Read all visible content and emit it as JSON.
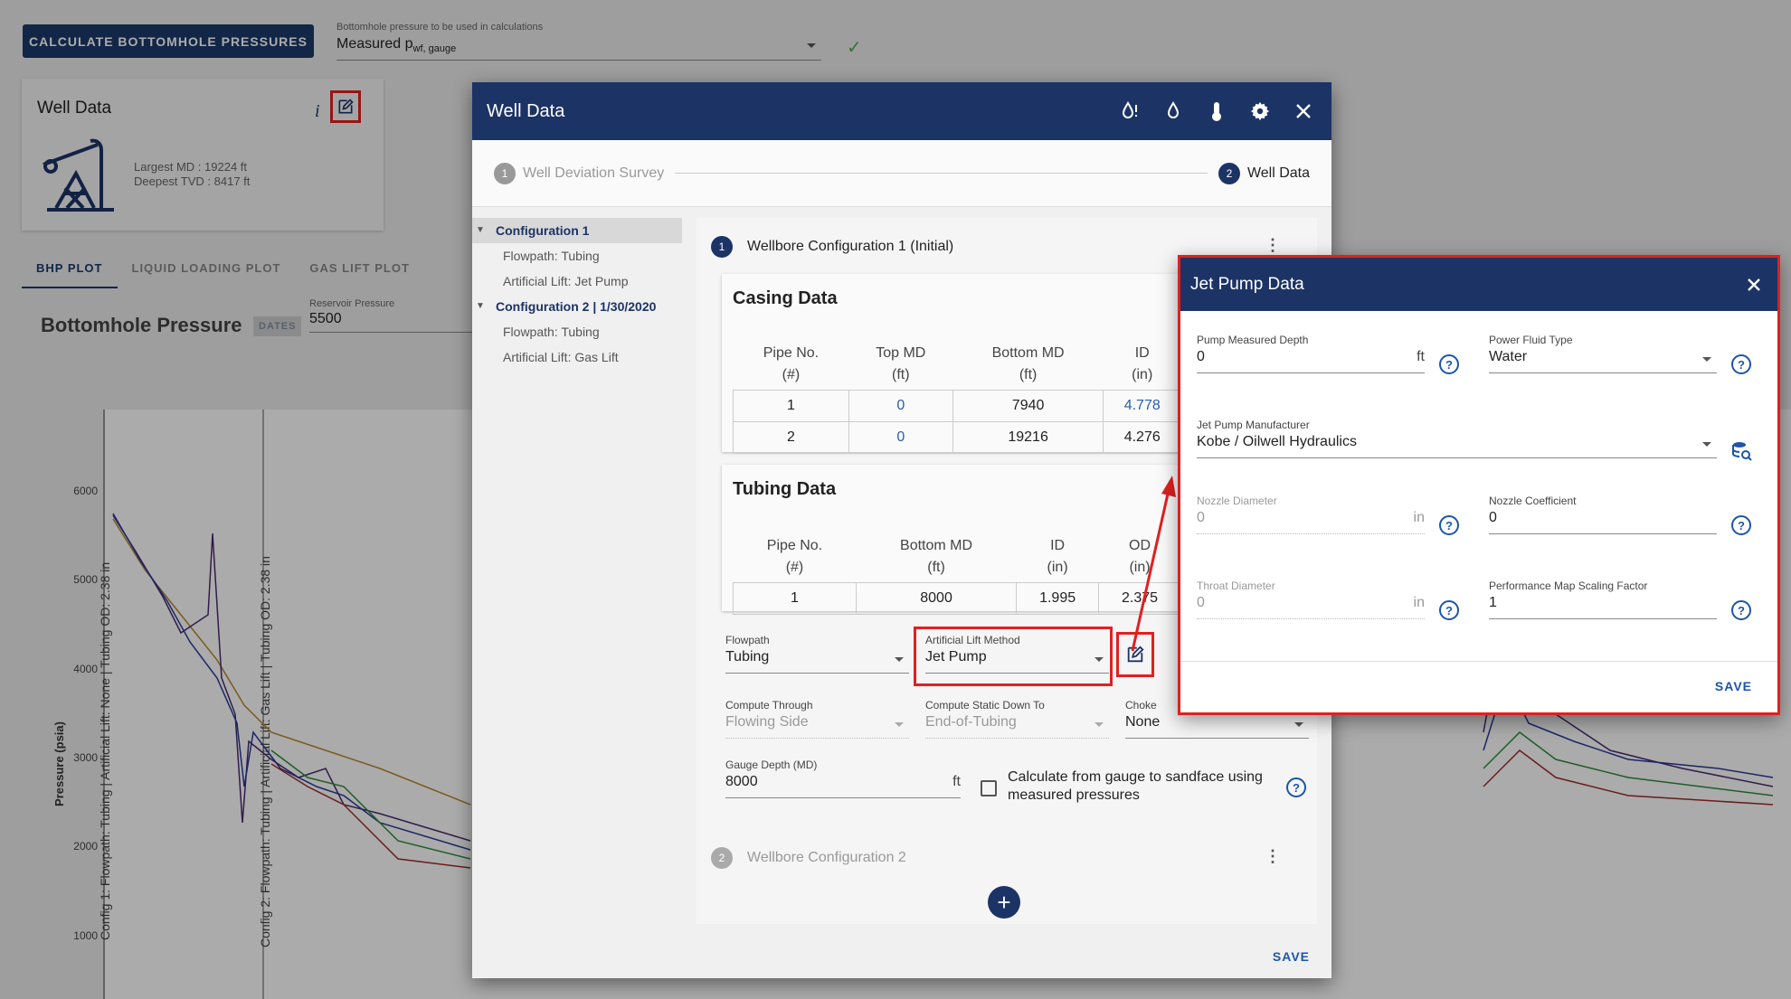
{
  "top": {
    "calc_button": "CALCULATE BOTTOMHOLE PRESSURES",
    "bhp_label": "Bottomhole pressure to be used in calculations",
    "bhp_value": "Measured p",
    "bhp_sub": "wf, gauge"
  },
  "well_card": {
    "title": "Well Data",
    "info": "i",
    "largest_md": "Largest MD :  19224 ft",
    "deepest_tvd": "Deepest TVD :  8417 ft"
  },
  "plot_tabs": [
    "BHP PLOT",
    "LIQUID LOADING PLOT",
    "GAS LIFT PLOT"
  ],
  "plot": {
    "title": "Bottomhole Pressure",
    "dates_badge": "DATES",
    "reservoir_label": "Reservoir Pressure",
    "reservoir_value": "5500",
    "ylabel": "Pressure (psia)",
    "yticks": [
      "6000",
      "5000",
      "4000",
      "3000",
      "2000",
      "1000"
    ],
    "config1_label": "Config 1: Flowpath: Tubing | Artificial Lift: None | Tubing OD: 2.38 in",
    "config2_label": "Config 2: Flowpath: Tubing | Artificial Lift: Gas Lift | Tubing OD: 2.38 in"
  },
  "well_dialog": {
    "title": "Well Data",
    "icons": [
      "oil-drop-alert-icon",
      "water-drop-icon",
      "thermometer-icon",
      "gear-icon",
      "close-icon"
    ],
    "steps": [
      {
        "num": "1",
        "label": "Well Deviation Survey"
      },
      {
        "num": "2",
        "label": "Well Data"
      }
    ],
    "tree": [
      {
        "label": "Configuration 1",
        "type": "root"
      },
      {
        "label": "Flowpath: Tubing",
        "type": "child"
      },
      {
        "label": "Artificial Lift: Jet Pump",
        "type": "child"
      },
      {
        "label": "Configuration 2 | 1/30/2020",
        "type": "root"
      },
      {
        "label": "Flowpath: Tubing",
        "type": "child"
      },
      {
        "label": "Artificial Lift: Gas Lift",
        "type": "child"
      }
    ],
    "config1": {
      "num": "1",
      "title": "Wellbore Configuration 1 (Initial)"
    },
    "casing": {
      "title": "Casing Data",
      "headers": [
        [
          "Pipe No.",
          "(#)"
        ],
        [
          "Top MD",
          "(ft)"
        ],
        [
          "Bottom MD",
          "(ft)"
        ],
        [
          "ID",
          "(in)"
        ]
      ],
      "rows": [
        [
          "1",
          "0",
          "7940",
          "4.778"
        ],
        [
          "2",
          "0",
          "19216",
          "4.276"
        ]
      ]
    },
    "tubing": {
      "title": "Tubing Data",
      "headers": [
        [
          "Pipe No.",
          "(#)"
        ],
        [
          "Bottom MD",
          "(ft)"
        ],
        [
          "ID",
          "(in)"
        ],
        [
          "OD",
          "(in)"
        ]
      ],
      "rows": [
        [
          "1",
          "8000",
          "1.995",
          "2.375"
        ]
      ]
    },
    "fields": {
      "flowpath_label": "Flowpath",
      "flowpath_value": "Tubing",
      "artificial_lift_label": "Artificial Lift Method",
      "artificial_lift_value": "Jet Pump",
      "compute_through_label": "Compute Through",
      "compute_through_value": "Flowing Side",
      "compute_static_label": "Compute Static Down To",
      "compute_static_value": "End-of-Tubing",
      "choke_label": "Choke",
      "choke_value": "None",
      "gauge_depth_label": "Gauge Depth (MD)",
      "gauge_depth_value": "8000",
      "gauge_depth_unit": "ft",
      "sandface_line1": "Calculate from gauge to sandface using",
      "sandface_line2": "measured pressures"
    },
    "config2": {
      "num": "2",
      "title": "Wellbore Configuration 2"
    },
    "save": "SAVE"
  },
  "jet_pump": {
    "title": "Jet Pump Data",
    "pump_depth_label": "Pump Measured Depth",
    "pump_depth_value": "0",
    "pump_depth_unit": "ft",
    "power_fluid_label": "Power Fluid Type",
    "power_fluid_value": "Water",
    "manufacturer_label": "Jet Pump Manufacturer",
    "manufacturer_value": "Kobe / Oilwell Hydraulics",
    "nozzle_dia_label": "Nozzle Diameter",
    "nozzle_dia_value": "0",
    "nozzle_dia_unit": "in",
    "nozzle_coef_label": "Nozzle Coefficient",
    "nozzle_coef_value": "0",
    "throat_dia_label": "Throat Diameter",
    "throat_dia_value": "0",
    "throat_dia_unit": "in",
    "scaling_label": "Performance Map Scaling Factor",
    "scaling_value": "1",
    "save": "SAVE"
  },
  "colors": {
    "primary": "#1c3366",
    "highlight": "#e02020",
    "link": "#2a5db0",
    "success": "#4caf50"
  }
}
